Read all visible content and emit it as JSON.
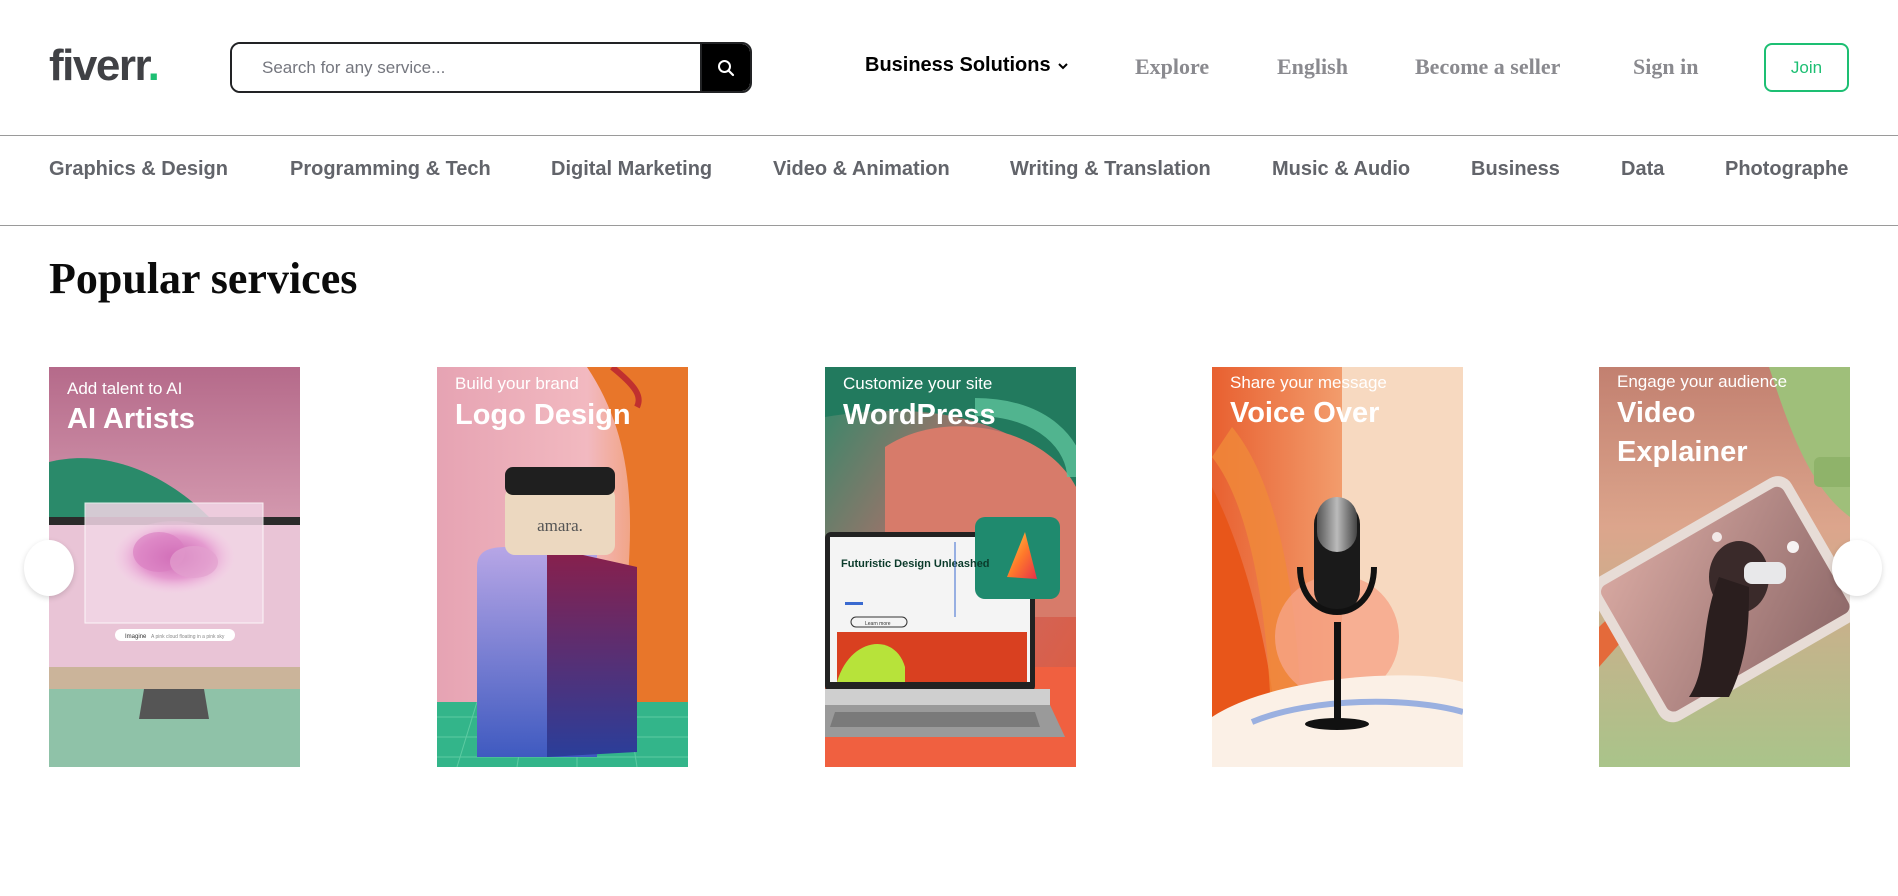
{
  "header": {
    "logo_text": "fiverr",
    "logo_dot": ".",
    "search_placeholder": "Search for any service...",
    "business_solutions": "Business Solutions",
    "explore": "Explore",
    "language": "English",
    "become_seller": "Become a seller",
    "sign_in": "Sign in",
    "join": "Join"
  },
  "categories": [
    "Graphics & Design",
    "Programming & Tech",
    "Digital Marketing",
    "Video & Animation",
    "Writing & Translation",
    "Music & Audio",
    "Business",
    "Data",
    "Photographe"
  ],
  "popular": {
    "title": "Popular services",
    "cards": [
      {
        "subtitle": "Add talent to AI",
        "title": "AI Artists"
      },
      {
        "subtitle": "Build your brand",
        "title": "Logo Design"
      },
      {
        "subtitle": "Customize your site",
        "title": "WordPress"
      },
      {
        "subtitle": "Share your message",
        "title": "Voice Over"
      },
      {
        "subtitle": "Engage your audience",
        "title_line1": "Video",
        "title_line2": "Explainer"
      }
    ]
  },
  "card_art_text": {
    "jar_label": "amara.",
    "laptop_heading": "Futuristic Design Unleashed",
    "laptop_button": "Learn more",
    "ai_prompt_label": "Imagine",
    "ai_prompt_text": "A pink cloud floating in a pink sky"
  },
  "colors": {
    "brand_green": "#1dbf73",
    "logo_gray": "#404145",
    "nav_gray": "#8a8a8f",
    "category_gray": "#62646a"
  },
  "icons": {
    "search": "magnifier-icon",
    "chevron": "chevron-down-icon"
  }
}
